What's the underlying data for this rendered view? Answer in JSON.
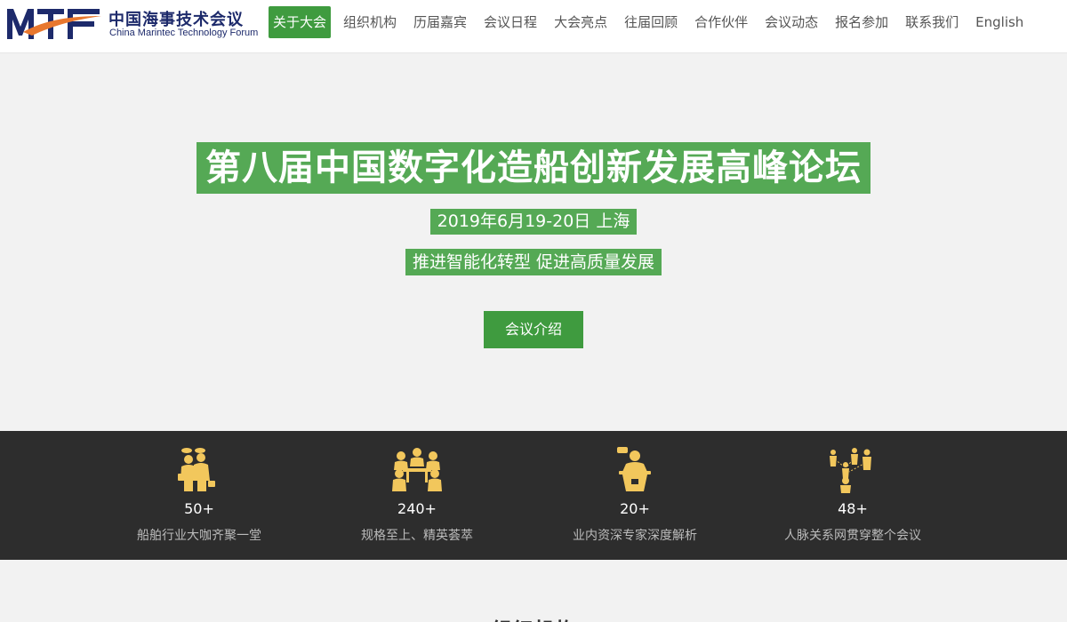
{
  "logo": {
    "mark_text": "MTF",
    "cn": "中国海事技术会议",
    "en": "China Marintec Technology Forum",
    "colors": {
      "navy": "#1d2a6b",
      "orange": "#e8772e"
    }
  },
  "nav": {
    "items": [
      {
        "label": "关于大会",
        "active": true
      },
      {
        "label": "组织机构"
      },
      {
        "label": "历届嘉宾"
      },
      {
        "label": "会议日程"
      },
      {
        "label": "大会亮点"
      },
      {
        "label": "往届回顾"
      },
      {
        "label": "合作伙伴"
      },
      {
        "label": "会议动态"
      },
      {
        "label": "报名参加"
      },
      {
        "label": "联系我们"
      },
      {
        "label": "English"
      }
    ]
  },
  "hero": {
    "title": "第八届中国数字化造船创新发展高峰论坛",
    "date": "2019年6月19-20日 上海",
    "slogan": "推进智能化转型 促进高质量发展",
    "button": "会议介绍"
  },
  "stats": [
    {
      "icon": "business-meeting-icon",
      "number": "50+",
      "desc": "船舶行业大咖齐聚一堂"
    },
    {
      "icon": "roundtable-icon",
      "number": "240+",
      "desc": "规格至上、精英荟萃"
    },
    {
      "icon": "speaker-podium-icon",
      "number": "20+",
      "desc": "业内资深专家深度解析"
    },
    {
      "icon": "network-people-icon",
      "number": "48+",
      "desc": "人脉关系网贯穿整个会议"
    }
  ],
  "section2": {
    "title": "组织机构"
  },
  "colors": {
    "accent_green": "#3f9b3f",
    "highlight_green": "#55a955",
    "dark_band": "#2d2d2d",
    "icon_gold": "#f2c75c"
  }
}
